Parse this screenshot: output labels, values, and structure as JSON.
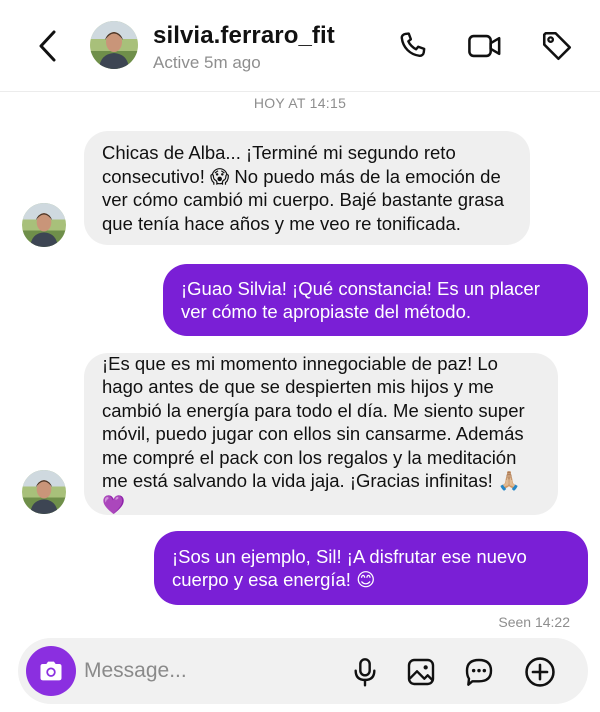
{
  "header": {
    "username": "silvia.ferraro_fit",
    "status": "Active 5m ago",
    "icons": [
      "back-arrow-icon",
      "phone-icon",
      "video-camera-icon",
      "tag-icon"
    ]
  },
  "chat": {
    "timestamp": "HOY AT 14:15",
    "messages": [
      {
        "direction": "incoming",
        "text": "Chicas de Alba... ¡Terminé mi segundo reto consecutivo! 😱 No puedo más de la emoción de ver cómo cambió mi cuerpo. Bajé bastante grasa que tenía hace años y me veo re tonificada."
      },
      {
        "direction": "outgoing",
        "text": "¡Guao Silvia! ¡Qué constancia! Es un placer ver cómo te apropiaste del método."
      },
      {
        "direction": "incoming",
        "text": "¡Es que es mi momento innegociable de paz! Lo hago antes de que se despierten mis hijos y me cambió la energía para todo el día. Me siento super móvil, puedo jugar con ellos sin cansarme. Además me compré el pack con los regalos y la meditación me está salvando la vida jaja. ¡Gracias infinitas! 🙏🏼💜"
      },
      {
        "direction": "outgoing",
        "text": "¡Sos un ejemplo, Sil! ¡A disfrutar ese nuevo cuerpo y esa energía! 😊"
      }
    ],
    "seen": "Seen 14:22"
  },
  "composer": {
    "placeholder": "Message...",
    "icons": [
      "camera-icon",
      "microphone-icon",
      "gallery-icon",
      "sticker-icon",
      "add-icon"
    ]
  },
  "colors": {
    "outgoing_bubble": "#7a1fd6",
    "incoming_bubble": "#efefef",
    "camera_button": "#8b2fe0",
    "muted_text": "#8e8e8e"
  }
}
